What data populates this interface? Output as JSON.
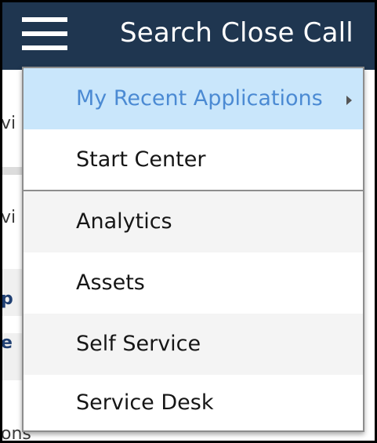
{
  "header": {
    "menu_icon": "hamburger-menu-icon",
    "title": "Search Close Call"
  },
  "background": {
    "fragment_1": "vi",
    "fragment_2": "vi",
    "fragment_3": "p",
    "fragment_4": "e",
    "fragment_5": "ons"
  },
  "menu": {
    "items": [
      {
        "label": "My Recent Applications",
        "has_submenu": true,
        "highlighted": true
      },
      {
        "label": "Start Center"
      },
      {
        "label": "Analytics"
      },
      {
        "label": "Assets"
      },
      {
        "label": "Self Service"
      },
      {
        "label": "Service Desk"
      }
    ],
    "submenu_icon": "chevron-right-icon"
  },
  "colors": {
    "header_bg": "#1f3650",
    "highlight_bg": "#c9e6fb",
    "highlight_text": "#4b8ad3"
  }
}
